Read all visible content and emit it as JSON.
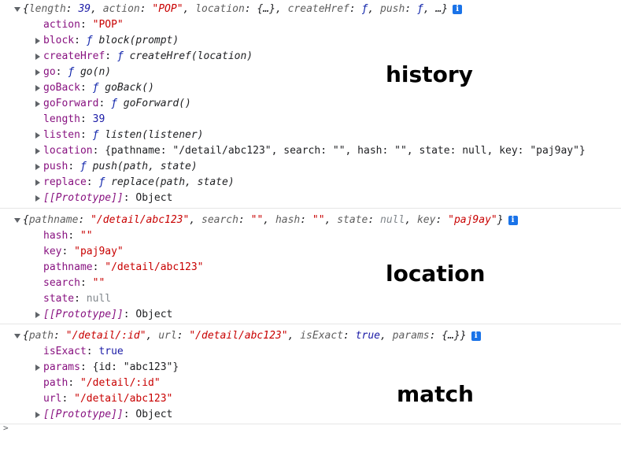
{
  "history": {
    "label": "history",
    "summary": {
      "prefix": "{",
      "k1": "length",
      "v1": "39",
      "k2": "action",
      "v2": "\"POP\"",
      "k3": "location",
      "v3": "{…}",
      "k4": "createHref",
      "v4": "ƒ",
      "k5": "push",
      "v5": "ƒ",
      "suffix": ", …}"
    },
    "props": [
      {
        "key": "action",
        "value": "\"POP\""
      },
      {
        "key": "block",
        "value": "ƒ",
        "sig": "block(prompt)"
      },
      {
        "key": "createHref",
        "value": "ƒ",
        "sig": "createHref(location)"
      },
      {
        "key": "go",
        "value": "ƒ",
        "sig": "go(n)"
      },
      {
        "key": "goBack",
        "value": "ƒ",
        "sig": "goBack()"
      },
      {
        "key": "goForward",
        "value": "ƒ",
        "sig": "goForward()"
      },
      {
        "key": "length",
        "value": "39"
      },
      {
        "key": "listen",
        "value": "ƒ",
        "sig": "listen(listener)"
      },
      {
        "key": "location",
        "value": "{pathname: \"/detail/abc123\", search: \"\", hash: \"\", state: null, key: \"paj9ay\"}"
      },
      {
        "key": "push",
        "value": "ƒ",
        "sig": "push(path, state)"
      },
      {
        "key": "replace",
        "value": "ƒ",
        "sig": "replace(path, state)"
      },
      {
        "key": "[[Prototype]]",
        "value": "Object"
      }
    ]
  },
  "location": {
    "label": "location",
    "summary": {
      "prefix": "{",
      "k1": "pathname",
      "v1": "\"/detail/abc123\"",
      "k2": "search",
      "v2": "\"\"",
      "k3": "hash",
      "v3": "\"\"",
      "k4": "state",
      "v4": "null",
      "k5": "key",
      "v5": "\"paj9ay\"",
      "suffix": "}"
    },
    "props": [
      {
        "key": "hash",
        "value": "\"\""
      },
      {
        "key": "key",
        "value": "\"paj9ay\""
      },
      {
        "key": "pathname",
        "value": "\"/detail/abc123\""
      },
      {
        "key": "search",
        "value": "\"\""
      },
      {
        "key": "state",
        "value": "null"
      },
      {
        "key": "[[Prototype]]",
        "value": "Object"
      }
    ]
  },
  "match": {
    "label": "match",
    "summary": {
      "prefix": "{",
      "k1": "path",
      "v1": "\"/detail/:id\"",
      "k2": "url",
      "v2": "\"/detail/abc123\"",
      "k3": "isExact",
      "v3": "true",
      "k4": "params",
      "v4": "{…}",
      "suffix": "}"
    },
    "props": [
      {
        "key": "isExact",
        "value": "true"
      },
      {
        "key": "params",
        "value": "{id: \"abc123\"}"
      },
      {
        "key": "path",
        "value": "\"/detail/:id\""
      },
      {
        "key": "url",
        "value": "\"/detail/abc123\""
      },
      {
        "key": "[[Prototype]]",
        "value": "Object"
      }
    ]
  },
  "info_icon_glyph": "i",
  "prompt_caret": ">"
}
